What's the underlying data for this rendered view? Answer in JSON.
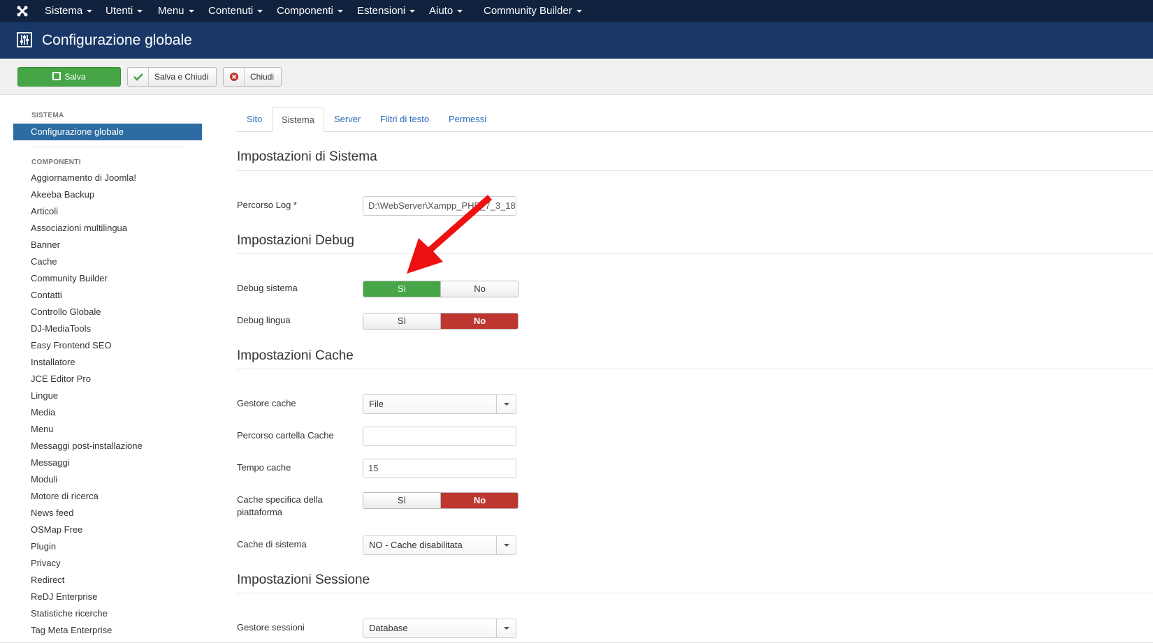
{
  "navbar": {
    "items": [
      "Sistema",
      "Utenti",
      "Menu",
      "Contenuti",
      "Componenti",
      "Estensioni",
      "Aiuto",
      "Community Builder"
    ]
  },
  "header": {
    "title": "Configurazione globale"
  },
  "toolbar": {
    "save": "Salva",
    "save_close": "Salva e Chiudi",
    "close": "Chiudi"
  },
  "sidebar": {
    "system_heading": "SISTEMA",
    "active_item": "Configurazione globale",
    "components_heading": "COMPONENTI",
    "items": [
      "Aggiornamento di Joomla!",
      "Akeeba Backup",
      "Articoli",
      "Associazioni multilingua",
      "Banner",
      "Cache",
      "Community Builder",
      "Contatti",
      "Controllo Globale",
      "DJ-MediaTools",
      "Easy Frontend SEO",
      "Installatore",
      "JCE Editor Pro",
      "Lingue",
      "Media",
      "Menu",
      "Messaggi post-installazione",
      "Messaggi",
      "Moduli",
      "Motore di ricerca",
      "News feed",
      "OSMap Free",
      "Plugin",
      "Privacy",
      "Redirect",
      "ReDJ Enterprise",
      "Statistiche ricerche",
      "Tag Meta Enterprise"
    ]
  },
  "tabs": [
    "Sito",
    "Sistema",
    "Server",
    "Filtri di testo",
    "Permessi"
  ],
  "sections": {
    "system": {
      "title": "Impostazioni di Sistema",
      "log_path_label": "Percorso Log *",
      "log_path_value": "D:\\WebServer\\Xampp_PHP_7_3_18"
    },
    "debug": {
      "title": "Impostazioni Debug",
      "debug_system_label": "Debug sistema",
      "debug_language_label": "Debug lingua",
      "yes": "Sì",
      "no": "No"
    },
    "cache": {
      "title": "Impostazioni Cache",
      "handler_label": "Gestore cache",
      "handler_value": "File",
      "path_label": "Percorso cartella Cache",
      "path_value": "",
      "time_label": "Tempo cache",
      "time_value": "15",
      "platform_label": "Cache specifica della piattaforma",
      "system_cache_label": "Cache di sistema",
      "system_cache_value": "NO - Cache disabilitata"
    },
    "session": {
      "title": "Impostazioni Sessione",
      "handler_label": "Gestore sessioni",
      "handler_value": "Database"
    }
  },
  "colors": {
    "navbar": "#10223e",
    "header": "#1a3867",
    "active": "#2d6ca2",
    "yes": "#46a546",
    "no": "#bd362f",
    "annotation": "#ee1111"
  }
}
